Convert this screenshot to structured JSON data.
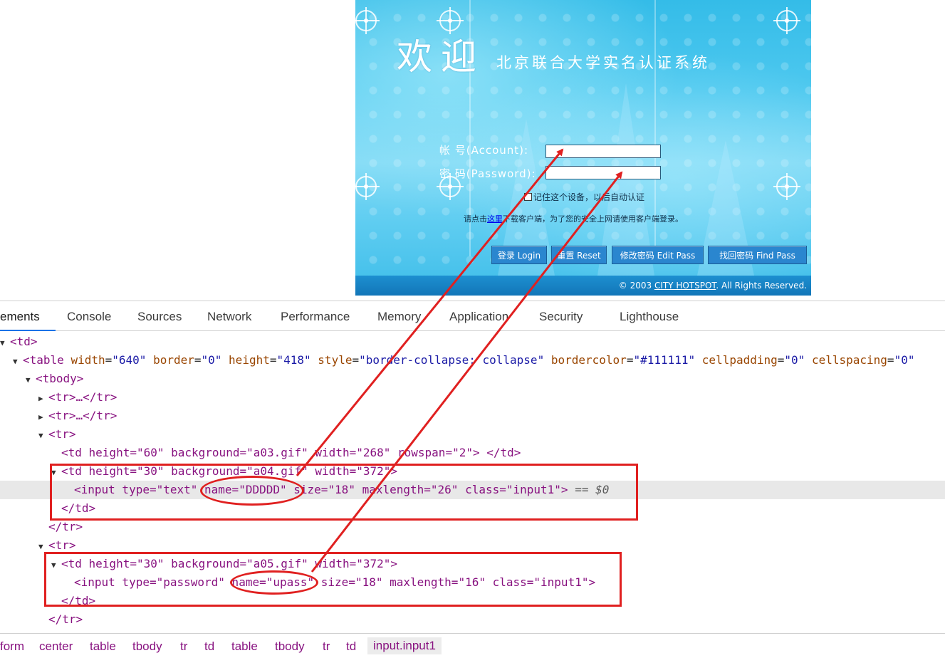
{
  "login_page": {
    "welcome": "欢迎",
    "system_title": "北京联合大学实名认证系统",
    "account_label": "帐 号(Account):",
    "password_label": "密 码(Password):",
    "account_value": "",
    "password_value": "",
    "remember_text": "记住这个设备，以后自动认证",
    "client_note_prefix": "请点击",
    "client_note_link": "这里",
    "client_note_suffix": "下载客户端，为了您的安全上网请使用客户端登录。",
    "buttons": {
      "login": "登录 Login",
      "reset": "重置 Reset",
      "edit_pass": "修改密码 Edit Pass",
      "find_pass": "找回密码 Find Pass"
    },
    "footer": {
      "prefix": "© 2003 ",
      "link": "CITY HOTSPOT",
      "suffix": ". All Rights Reserved."
    }
  },
  "devtools": {
    "tabs": [
      "ements",
      "Console",
      "Sources",
      "Network",
      "Performance",
      "Memory",
      "Application",
      "Security",
      "Lighthouse"
    ],
    "active_tab": "ements",
    "dom": {
      "line0_tag": "<td>",
      "table_tag": "<table",
      "table_attrs": [
        {
          "name": "width",
          "value": "\"640\""
        },
        {
          "name": "border",
          "value": "\"0\""
        },
        {
          "name": "height",
          "value": "\"418\""
        },
        {
          "name": "style",
          "value": "\"border-collapse: collapse\""
        },
        {
          "name": "bordercolor",
          "value": "\"#111111\""
        },
        {
          "name": "cellpadding",
          "value": "\"0\""
        },
        {
          "name": "cellspacing",
          "value": "\"0\""
        }
      ],
      "tbody": "<tbody>",
      "collapsed_tr": "<tr>…</tr>",
      "tr_open": "<tr>",
      "tr_close": "</tr>",
      "td_close": "</td>",
      "td_a03": "<td height=\"60\" background=\"a03.gif\" width=\"268\" rowspan=\"2\"> </td>",
      "td_a04": "<td height=\"30\" background=\"a04.gif\" width=\"372\">",
      "input_text": "<input type=\"text\" name=\"DDDDD\" size=\"18\" maxlength=\"26\" class=\"input1\">",
      "selected_marker": "== $0",
      "td_a05": "<td height=\"30\" background=\"a05.gif\" width=\"372\">",
      "input_password": "<input type=\"password\" name=\"upass\" size=\"18\" maxlength=\"16\" class=\"input1\">"
    },
    "breadcrumbs": [
      "form",
      "center",
      "table",
      "tbody",
      "tr",
      "td",
      "table",
      "tbody",
      "tr",
      "td",
      "input.input1"
    ]
  }
}
